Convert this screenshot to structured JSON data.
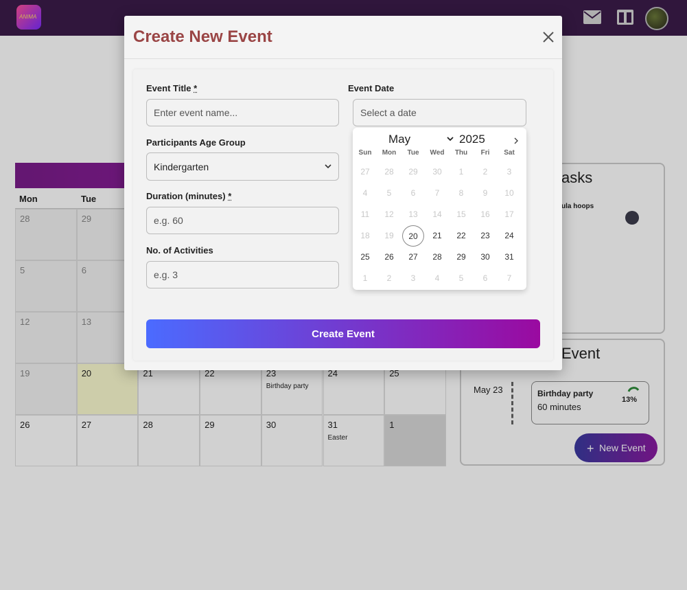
{
  "app": {
    "logo_text": "ANIMA"
  },
  "calendar": {
    "day_names": [
      "Mon",
      "Tue"
    ],
    "cells": [
      {
        "day": "28",
        "muted": true
      },
      {
        "day": "29",
        "muted": true
      },
      {
        "day": "5",
        "muted": true
      },
      {
        "day": "6",
        "muted": true
      },
      {
        "day": "12",
        "muted": true
      },
      {
        "day": "13",
        "muted": true
      },
      {
        "day": "19",
        "muted": true
      },
      {
        "day": "20",
        "today": true
      },
      {
        "day": "21"
      },
      {
        "day": "22"
      },
      {
        "day": "23",
        "event": "Birthday party"
      },
      {
        "day": "24"
      },
      {
        "day": "25"
      },
      {
        "day": "26"
      },
      {
        "day": "27"
      },
      {
        "day": "28"
      },
      {
        "day": "29"
      },
      {
        "day": "30"
      },
      {
        "day": "31",
        "event": "Easter"
      },
      {
        "day": "1",
        "gray": true
      }
    ]
  },
  "tasks_panel": {
    "title_fragment": "asks",
    "item_fragment": "ula hoops"
  },
  "event_panel": {
    "title_fragment": "Event",
    "date": "May 23",
    "event_name": "Birthday party",
    "event_duration": "60 minutes",
    "progress": "13%",
    "new_event_label": "New Event"
  },
  "modal": {
    "title": "Create New Event",
    "event_title_label": "Event Title",
    "event_title_placeholder": "Enter event name...",
    "event_date_label": "Event Date",
    "event_date_placeholder": "Select a date",
    "age_group_label": "Participants Age Group",
    "age_group_value": "Kindergarten",
    "duration_label": "Duration (minutes)",
    "duration_placeholder": "e.g. 60",
    "activities_label": "No. of Activities",
    "activities_placeholder": "e.g. 3",
    "required_mark": "*",
    "submit_label": "Create Event"
  },
  "datepicker": {
    "month": "May",
    "year": "2025",
    "weekdays": [
      "Sun",
      "Mon",
      "Tue",
      "Wed",
      "Thu",
      "Fri",
      "Sat"
    ],
    "weeks": [
      [
        "27",
        "28",
        "29",
        "30",
        "1",
        "2",
        "3"
      ],
      [
        "4",
        "5",
        "6",
        "7",
        "8",
        "9",
        "10"
      ],
      [
        "11",
        "12",
        "13",
        "14",
        "15",
        "16",
        "17"
      ],
      [
        "18",
        "19",
        "20",
        "21",
        "22",
        "23",
        "24"
      ],
      [
        "25",
        "26",
        "27",
        "28",
        "29",
        "30",
        "31"
      ],
      [
        "1",
        "2",
        "3",
        "4",
        "5",
        "6",
        "7"
      ]
    ],
    "today": "20"
  },
  "colors": {
    "modal_title": "#9a4545",
    "button_start": "#4b6bff",
    "button_end": "#9a0aa0",
    "topbar": "#3b1c4a"
  }
}
